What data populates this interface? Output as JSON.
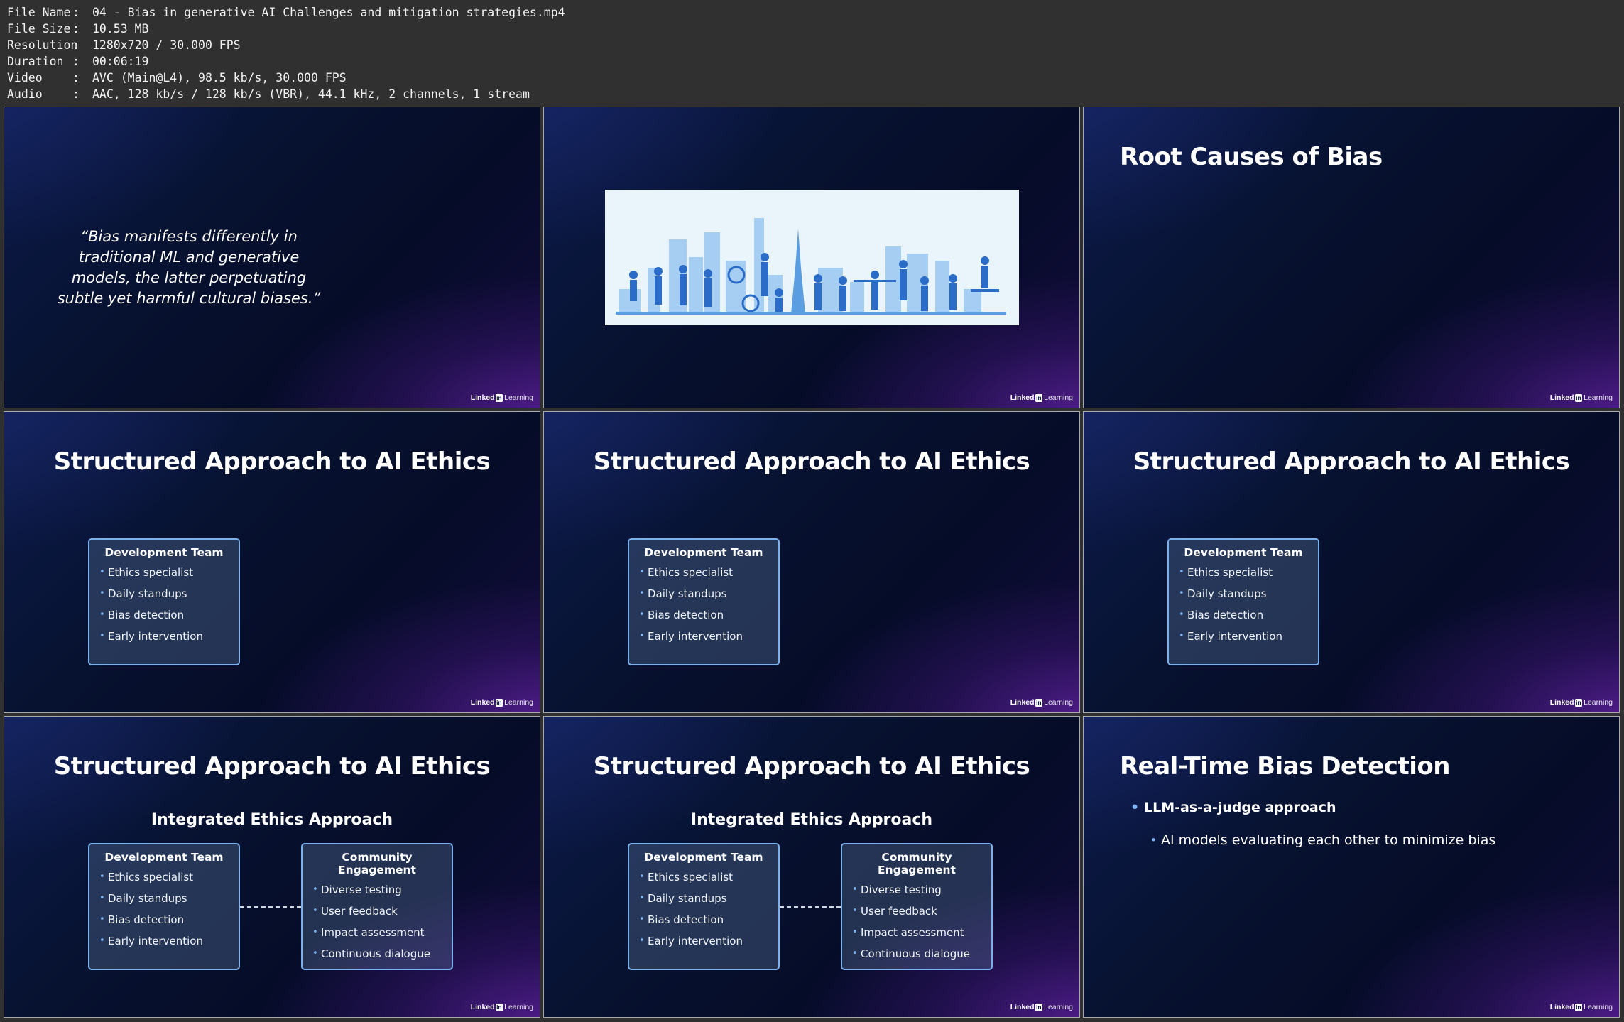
{
  "metadata": [
    {
      "key": "File Name",
      "value": "04 - Bias in generative AI Challenges and mitigation strategies.mp4"
    },
    {
      "key": "File Size",
      "value": "10.53 MB"
    },
    {
      "key": "Resolution",
      "value": "1280x720 / 30.000 FPS"
    },
    {
      "key": "Duration",
      "value": "00:06:19"
    },
    {
      "key": "Video",
      "value": "AVC (Main@L4), 98.5 kb/s, 30.000 FPS"
    },
    {
      "key": "Audio",
      "value": "AAC, 128 kb/s / 128 kb/s (VBR), 44.1 kHz, 2 channels, 1 stream"
    }
  ],
  "brand": {
    "part1": "Linked",
    "part2": "in",
    "part3": "Learning"
  },
  "quote": "“Bias manifests differently in traditional ML and generative models, the latter perpetuating subtle yet harmful cultural biases.”",
  "titles": {
    "root_causes": "Root Causes of Bias",
    "structured": "Structured Approach to AI Ethics",
    "realtime": "Real-Time Bias Detection"
  },
  "subhead": "Integrated Ethics Approach",
  "dev_team": {
    "title": "Development Team",
    "items": [
      "Ethics specialist",
      "Daily standups",
      "Bias detection",
      "Early intervention"
    ]
  },
  "community": {
    "title": "Community Engagement",
    "items": [
      "Diverse testing",
      "User feedback",
      "Impact assessment",
      "Continuous dialogue"
    ]
  },
  "realtime_bullets": {
    "level1": "LLM-as-a-judge approach",
    "level2": "AI models evaluating each other to minimize bias"
  },
  "colors": {
    "accent": "#7ab1ec",
    "background": "#303030",
    "slide_dark": "#071230",
    "slide_purple": "#5a1e9a"
  }
}
